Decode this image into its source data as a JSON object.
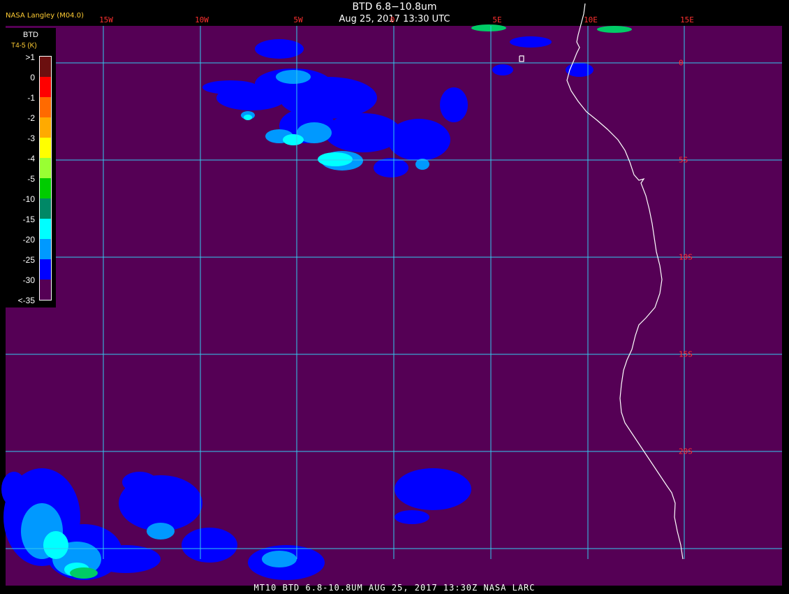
{
  "header": {
    "title": "BTD 6.8−10.8um",
    "subtitle": "Aug 25, 2017 13:30 UTC",
    "organization": "NASA Langley (M04.0)"
  },
  "legend": {
    "title": "BTD",
    "units": "T4-5 (K)",
    "labels": [
      ">1",
      "0",
      "-1",
      "-2",
      "-3",
      "-4",
      "-5",
      "-10",
      "-15",
      "-20",
      "-25",
      "-30",
      "<-35"
    ],
    "colors": [
      "#6b0f0f",
      "#ff0000",
      "#ff6a00",
      "#ffaa00",
      "#ffff00",
      "#99ff33",
      "#00cc00",
      "#008866",
      "#00ffff",
      "#0099ff",
      "#0000ff",
      "#550055"
    ]
  },
  "map": {
    "lon_labels": [
      "15W",
      "10W",
      "5W",
      "0",
      "5E",
      "10E",
      "15E"
    ],
    "lat_labels": [
      "0",
      "5S",
      "10S",
      "15S",
      "20S"
    ],
    "colors": {
      "ocean": "#550055",
      "grid": "#33ccee",
      "coast": "#ffffff",
      "cloud_deep": "#0000ff",
      "cloud_mid": "#0099ff",
      "cloud_light": "#00ffff",
      "cloud_green": "#00cc66"
    }
  },
  "footer": {
    "text": "MT10  BTD 6.8-10.8UM  AUG 25, 2017 13:30Z  NASA LARC"
  }
}
